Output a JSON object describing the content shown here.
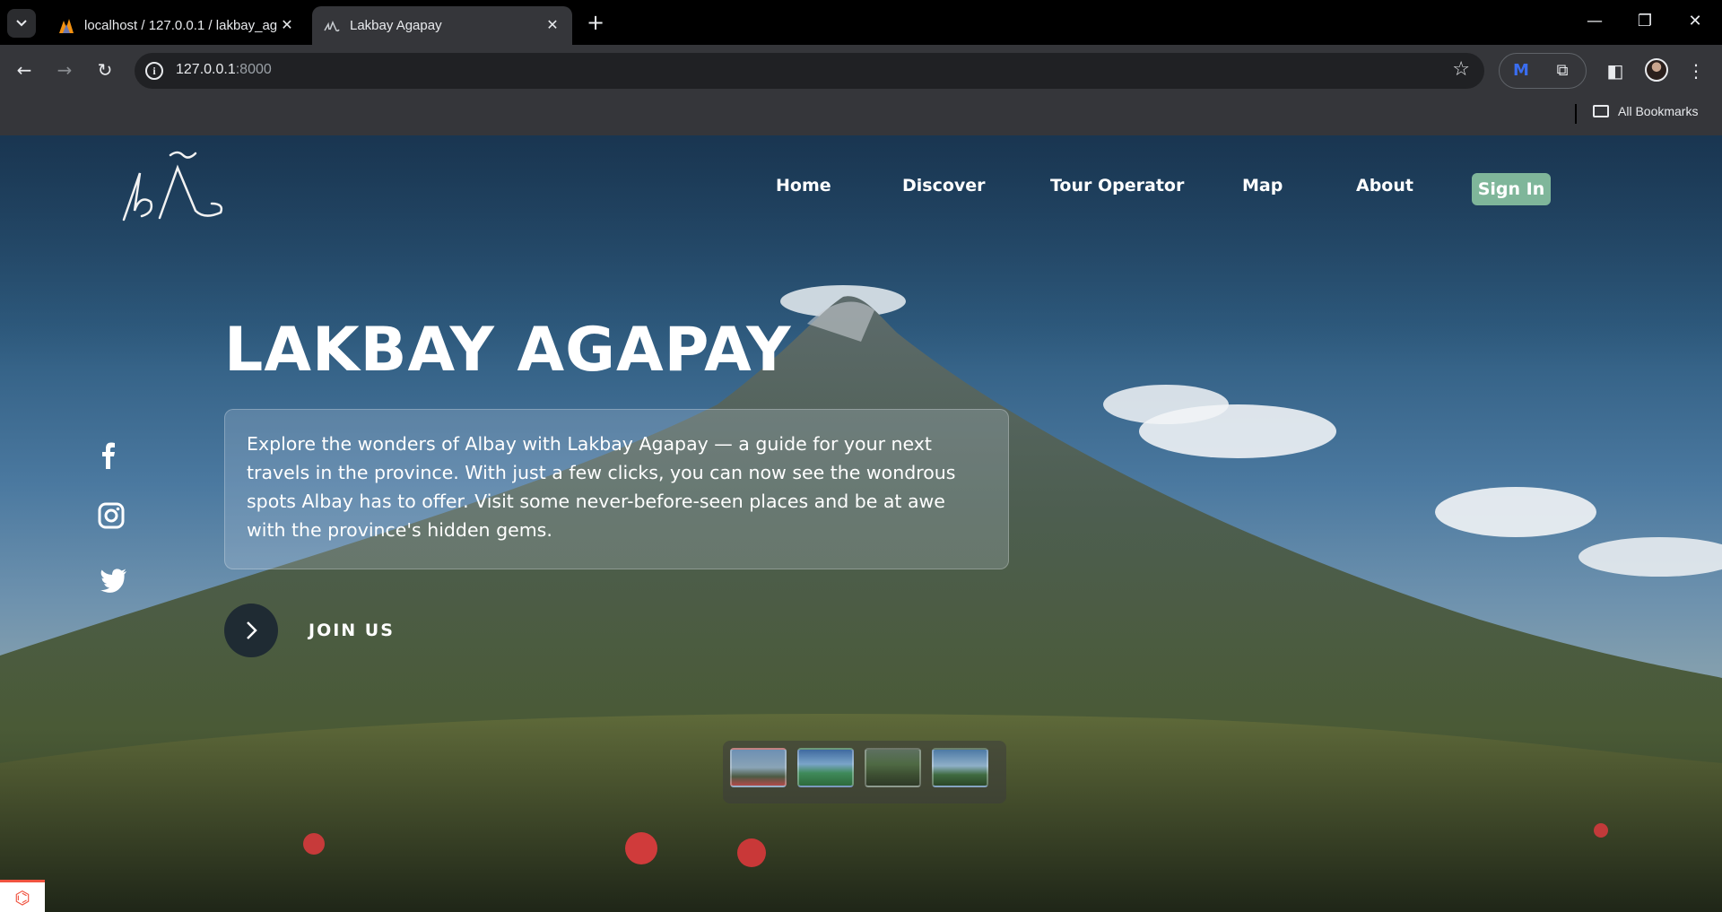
{
  "browser": {
    "tabs": [
      {
        "title": "localhost / 127.0.0.1 / lakbay_ag"
      },
      {
        "title": "Lakbay Agapay"
      }
    ],
    "new_tab": "+",
    "close": "✕",
    "url_host": "127.0.0.1",
    "url_port": ":8000",
    "bookmarks_label": "All Bookmarks"
  },
  "nav": {
    "items": [
      "Home",
      "Discover",
      "Tour Operator",
      "Map",
      "About"
    ],
    "sign_in": "Sign In"
  },
  "hero": {
    "title": "LAKBAY AGAPAY",
    "description": "Explore the wonders of Albay with Lakbay Agapay — a guide for your next travels in the province. With just a few clicks, you can now see the wondrous spots Albay has to offer. Visit some never-before-seen places and be at awe with the province's hidden gems.",
    "cta": "JOIN US"
  },
  "social": [
    "facebook-icon",
    "instagram-icon",
    "twitter-icon"
  ],
  "colors": {
    "accent": "#7fb69a",
    "dark_button": "#1f2b33"
  }
}
